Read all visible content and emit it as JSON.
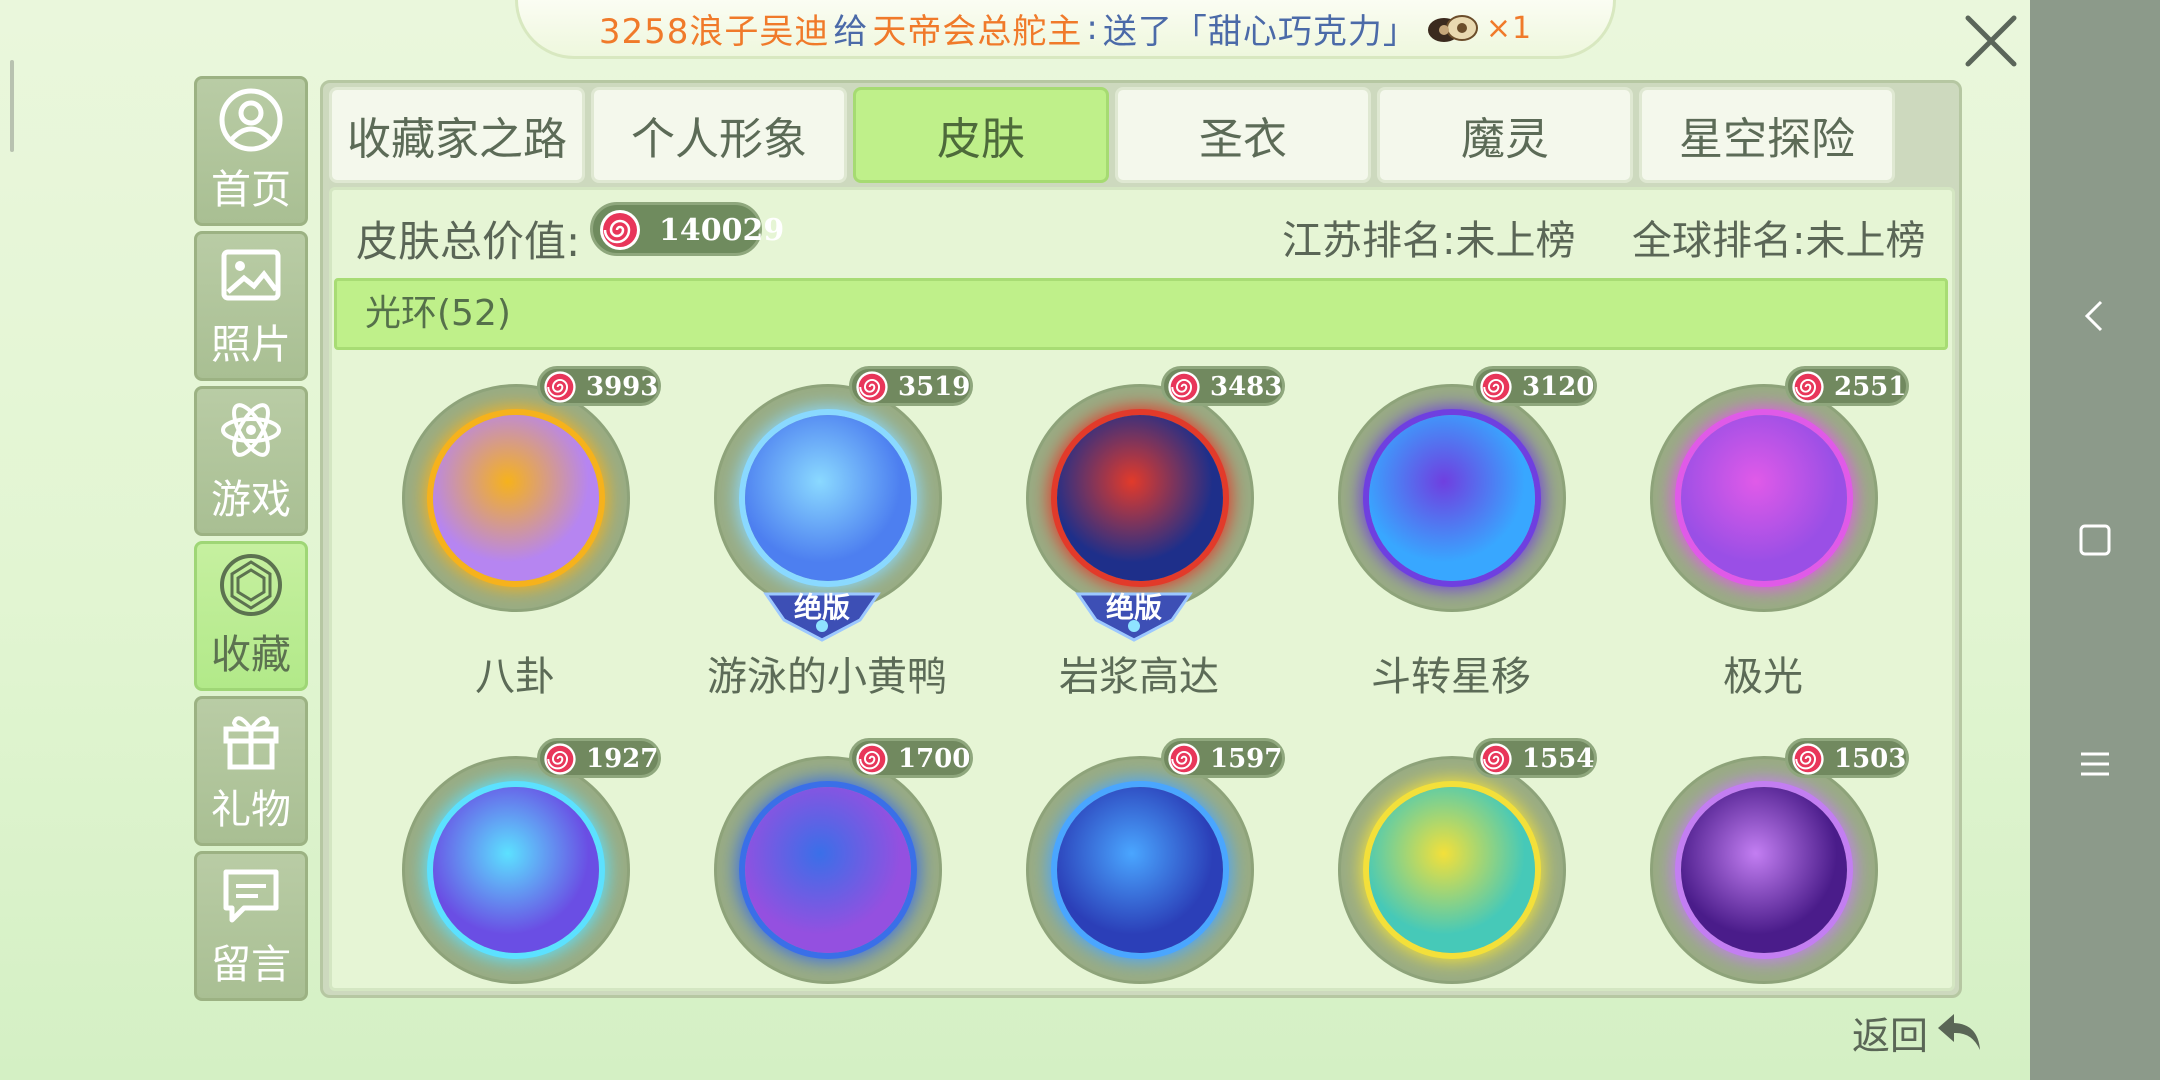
{
  "broadcast": {
    "sender": "3258浪子吴迪",
    "verb": "给",
    "receiver": "天帝会总舵主",
    "colon": ":",
    "action": "送了「甜心巧克力」",
    "count": "×1"
  },
  "sidebar": {
    "items": [
      {
        "label": "首页",
        "icon": "user-icon"
      },
      {
        "label": "照片",
        "icon": "image-icon"
      },
      {
        "label": "游戏",
        "icon": "atom-icon"
      },
      {
        "label": "收藏",
        "icon": "gem-icon",
        "active": true
      },
      {
        "label": "礼物",
        "icon": "gift-icon"
      },
      {
        "label": "留言",
        "icon": "message-icon"
      }
    ]
  },
  "tabs": [
    {
      "label": "收藏家之路"
    },
    {
      "label": "个人形象"
    },
    {
      "label": "皮肤",
      "active": true
    },
    {
      "label": "圣衣"
    },
    {
      "label": "魔灵"
    },
    {
      "label": "星空探险"
    }
  ],
  "summary": {
    "total_label": "皮肤总价值:",
    "total_value": "140029",
    "province_rank": "江苏排名:未上榜",
    "global_rank": "全球排名:未上榜"
  },
  "category": {
    "title": "光环(52)"
  },
  "items": [
    {
      "name": "八卦",
      "price": "3993",
      "colors": [
        "#b685f1",
        "#f6b21c"
      ],
      "limited": false
    },
    {
      "name": "游泳的小黄鸭",
      "price": "3519",
      "colors": [
        "#4d7ff0",
        "#8ad9ff"
      ],
      "limited": true
    },
    {
      "name": "岩浆高达",
      "price": "3483",
      "colors": [
        "#1e2f8a",
        "#e23a2a"
      ],
      "limited": true
    },
    {
      "name": "斗转星移",
      "price": "3120",
      "colors": [
        "#38a7ff",
        "#6f3fe0"
      ],
      "limited": false
    },
    {
      "name": "极光",
      "price": "2551",
      "colors": [
        "#9a4fe6",
        "#e05ae8"
      ],
      "limited": false
    },
    {
      "name": "",
      "price": "1927",
      "colors": [
        "#6a4ee4",
        "#5ce1ff"
      ],
      "limited": false
    },
    {
      "name": "",
      "price": "1700",
      "colors": [
        "#9450e0",
        "#3a6fe8"
      ],
      "limited": false
    },
    {
      "name": "",
      "price": "1597",
      "colors": [
        "#2b3fb8",
        "#4aa6ff"
      ],
      "limited": false
    },
    {
      "name": "",
      "price": "1554",
      "colors": [
        "#46c9b8",
        "#f3e03a"
      ],
      "limited": false
    },
    {
      "name": "",
      "price": "1503",
      "colors": [
        "#4a1c8a",
        "#c37ef2"
      ],
      "limited": false
    }
  ],
  "limited_label": "绝版",
  "back_label": "返回",
  "colors": {
    "accent": "#bff08a",
    "candy": "#e8365a"
  }
}
